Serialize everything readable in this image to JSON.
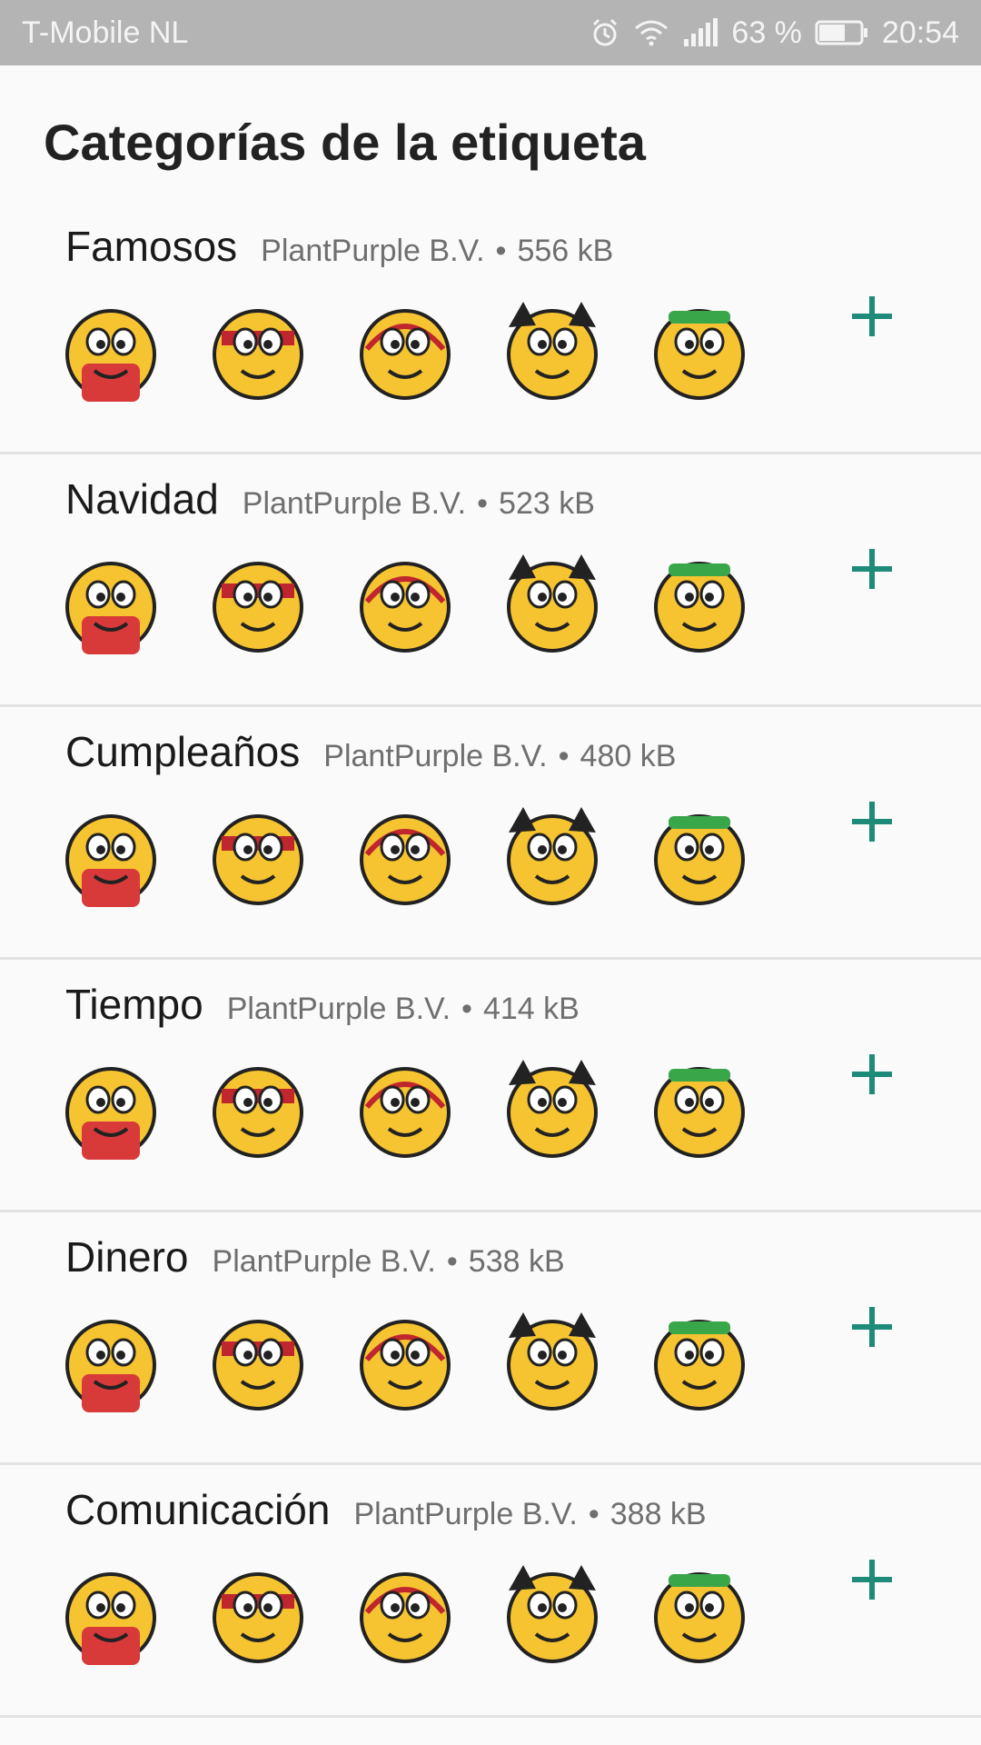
{
  "status_bar": {
    "carrier": "T-Mobile  NL",
    "battery": "63 %",
    "time": "20:54",
    "icons": [
      "alarm-icon",
      "wifi-icon",
      "signal-icon",
      "battery-icon"
    ]
  },
  "page_title": "Categorías de la etiqueta",
  "accent_color": "#1e8a78",
  "sections": [
    {
      "name": "Famosos",
      "publisher": "PlantPurple B.V.",
      "size": "556 kB",
      "stickers": [
        "superhero-emoji",
        "ninja-emoji",
        "spider-hero-emoji",
        "bat-hero-emoji",
        "green-hero-emoji"
      ]
    },
    {
      "name": "Navidad",
      "publisher": "PlantPurple B.V.",
      "size": "523 kB",
      "stickers": [
        "christmas-tree-emoji",
        "santa-hat-emoji",
        "stocking-emoji",
        "santa-chimney-emoji",
        "candy-cane-emoji"
      ]
    },
    {
      "name": "Cumpleaños",
      "publisher": "PlantPurple B.V.",
      "size": "480 kB",
      "stickers": [
        "birthday-cake-emoji",
        "happy-birthday-shirt-emoji",
        "birthday-card-emoji",
        "presents-emoji",
        "blowing-candles-emoji"
      ]
    },
    {
      "name": "Tiempo",
      "publisher": "PlantPurple B.V.",
      "size": "414 kB",
      "stickers": [
        "umbrella-emoji",
        "rain-umbrella-emoji",
        "crying-rain-emoji",
        "storm-cloud-emoji",
        "rainbow-emoji"
      ]
    },
    {
      "name": "Dinero",
      "publisher": "PlantPurple B.V.",
      "size": "538 kB",
      "stickers": [
        "money-coins-emoji",
        "money-rain-emoji",
        "green-money-emoji",
        "money-drip-emoji",
        "grinning-diamond-emoji"
      ]
    },
    {
      "name": "Comunicación",
      "publisher": "PlantPurple B.V.",
      "size": "388 kB",
      "stickers": [
        "facebook-like-emoji",
        "computer-screen-emoji",
        "follow-me-emoji",
        "foursquare-shirt-emoji",
        "instagram-camera-emoji"
      ]
    }
  ]
}
